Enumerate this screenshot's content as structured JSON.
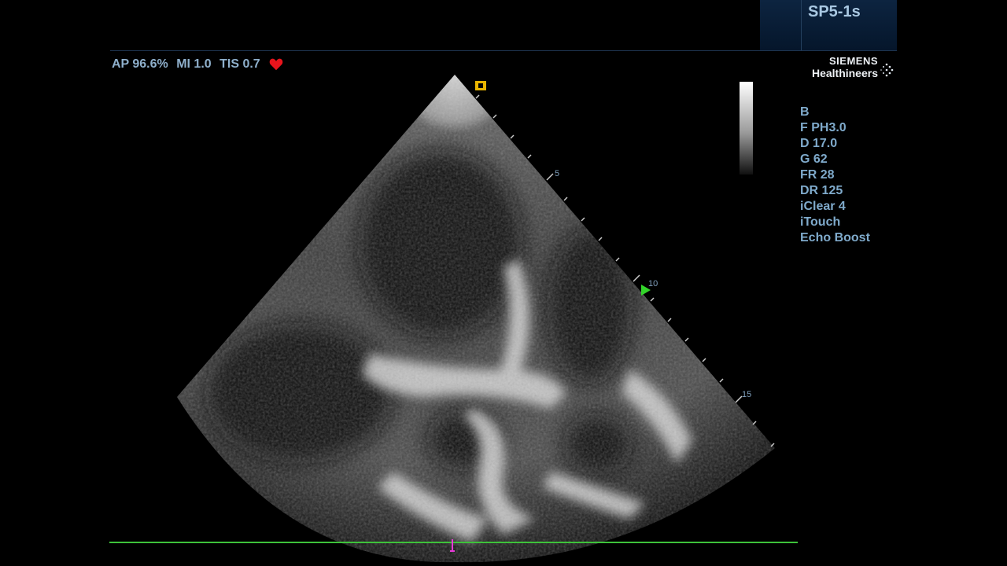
{
  "probe": "SP5-1s",
  "power_readout": {
    "ap": "AP 96.6%",
    "mi": "MI 1.0",
    "tis": "TIS 0.7"
  },
  "brand": {
    "line1": "SIEMENS",
    "line2": "Healthineers"
  },
  "params": [
    "B",
    "F PH3.0",
    "D 17.0",
    "G 62",
    "FR 28",
    "DR 125",
    "iClear 4",
    "iTouch",
    "Echo Boost"
  ],
  "depth_labels": [
    "5",
    "10",
    "15"
  ],
  "colors": {
    "text_blue": "#7faacb",
    "heart": "#e8141c",
    "ecg_baseline": "#3ec23a",
    "focus_marker": "#33d42a",
    "orientation_marker": "#e8b400"
  },
  "icons": {
    "heart": "heart-icon",
    "orientation": "orientation-marker-icon",
    "focus": "focus-marker-icon",
    "brand": "siemens-dots-icon"
  }
}
